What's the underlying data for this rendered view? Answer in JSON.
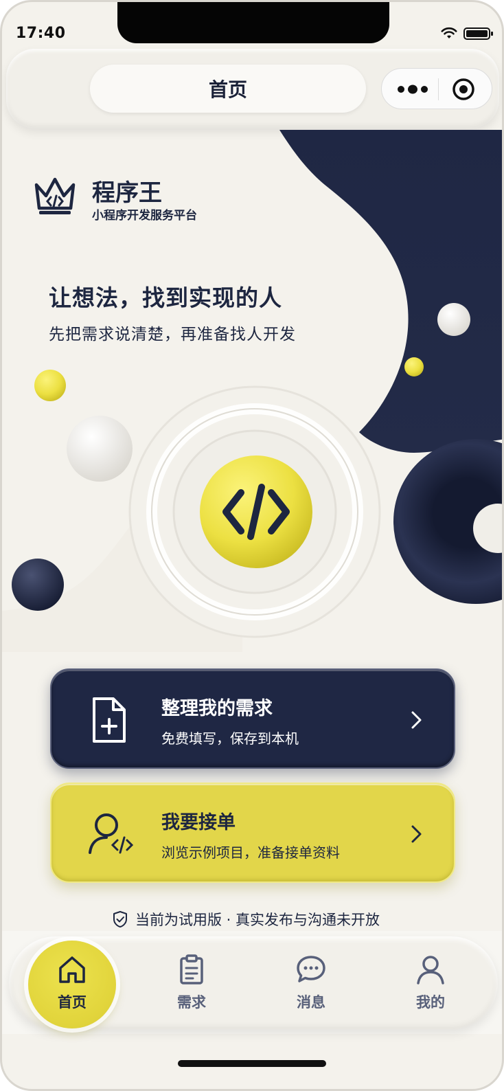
{
  "status_bar": {
    "time": "17:40"
  },
  "title_bar": {
    "title": "首页"
  },
  "hero": {
    "brand_name": "程序王",
    "brand_subtitle": "小程序开发服务平台",
    "headline": "让想法，找到实现的人",
    "subline": "先把需求说清楚，再准备找人开发"
  },
  "actions": [
    {
      "title": "整理我的需求",
      "description": "免费填写，保存到本机",
      "icon": "document-plus-icon",
      "color": "#1f2744"
    },
    {
      "title": "我要接单",
      "description": "浏览示例项目，准备接单资料",
      "icon": "developer-user-icon",
      "color": "#e2d64a"
    }
  ],
  "notice": {
    "text": "当前为试用版 · 真实发布与沟通未开放",
    "icon": "shield-check-icon"
  },
  "tabbar": {
    "active": "首页",
    "items": [
      {
        "label": "首页",
        "icon": "home-icon"
      },
      {
        "label": "需求",
        "icon": "clipboard-icon"
      },
      {
        "label": "消息",
        "icon": "chat-bubble-icon"
      },
      {
        "label": "我的",
        "icon": "user-icon"
      }
    ]
  },
  "colors": {
    "navy": "#1d2640",
    "yellow": "#e2d64a",
    "background": "#f4f2ec"
  }
}
